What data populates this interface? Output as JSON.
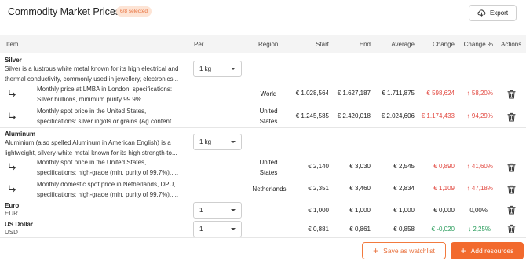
{
  "header": {
    "title": "Commodity Market Prices",
    "badge": "6/8 selected",
    "export_label": "Export"
  },
  "columns": {
    "item": "Item",
    "per": "Per",
    "region": "Region",
    "start": "Start",
    "end": "End",
    "average": "Average",
    "change": "Change",
    "change_pct": "Change %",
    "actions": "Actions"
  },
  "resources": {
    "silver": {
      "name": "Silver",
      "desc": "Silver is a lustrous white metal known for its high electrical and thermal conductivity, commonly used in jewellery, electronics...",
      "per": "1 kg",
      "rows": [
        {
          "desc": "Monthly price at LMBA in London, specifications: Silver bullions, minimum purity 99.9%.....",
          "region": "World",
          "start": "€ 1.028,564",
          "end": "€ 1.627,187",
          "average": "€ 1.711,875",
          "change": "€ 598,624",
          "change_pct": "↑ 58,20%"
        },
        {
          "desc": "Monthly spot price in the United States, specifications: silver ingots or grains (Ag content ...",
          "region": "United States",
          "start": "€ 1.245,585",
          "end": "€ 2.420,018",
          "average": "€ 2.024,606",
          "change": "€ 1.174,433",
          "change_pct": "↑ 94,29%"
        }
      ]
    },
    "aluminum": {
      "name": "Aluminum",
      "desc": "Aluminium (also spelled Aluminum in American English) is a lightweight, silvery-white metal known for its high strength-to...",
      "per": "1 kg",
      "rows": [
        {
          "desc": "Monthly spot price in the United States, specifications: high-grade (min. purity of 99.7%).....",
          "region": "United States",
          "start": "€ 2,140",
          "end": "€ 3,030",
          "average": "€ 2,545",
          "change": "€ 0,890",
          "change_pct": "↑ 41,60%"
        },
        {
          "desc": "Monthly domestic spot price in Netherlands, DPU, specifications: high-grade (min. purity of 99.7%).....",
          "region": "Netherlands",
          "start": "€ 2,351",
          "end": "€ 3,460",
          "average": "€ 2,834",
          "change": "€ 1,109",
          "change_pct": "↑ 47,18%"
        }
      ]
    },
    "euro": {
      "name": "Euro",
      "code": "EUR",
      "per": "1",
      "start": "€ 1,000",
      "end": "€ 1,000",
      "average": "€ 1,000",
      "change": "€ 0,000",
      "change_pct": "0,00%"
    },
    "usd": {
      "name": "US Dollar",
      "code": "USD",
      "per": "1",
      "start": "€ 0,881",
      "end": "€ 0,861",
      "average": "€ 0,858",
      "change": "€ -0,020",
      "change_pct": "↓ 2,25%"
    }
  },
  "footer": {
    "watchlist_label": "Save as watchlist",
    "add_label": "Add resources"
  },
  "colors": {
    "accent": "#f26a2e",
    "negative": "#e24a42",
    "positive": "#2a9d5c"
  },
  "icons": [
    "cloud-download-icon",
    "sub-row-arrow-icon",
    "chevron-down-icon",
    "trash-icon",
    "plus-icon"
  ]
}
